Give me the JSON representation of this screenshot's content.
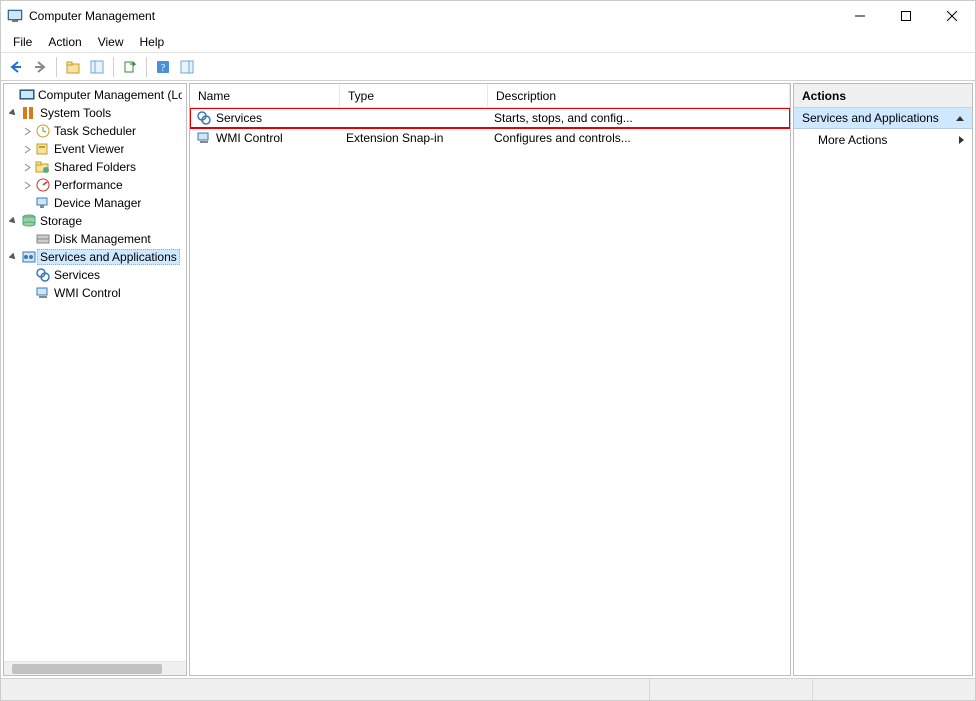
{
  "window": {
    "title": "Computer Management"
  },
  "menu": {
    "file": "File",
    "action": "Action",
    "view": "View",
    "help": "Help"
  },
  "tree": {
    "root": "Computer Management (Local)",
    "system_tools": "System Tools",
    "task_scheduler": "Task Scheduler",
    "event_viewer": "Event Viewer",
    "shared_folders": "Shared Folders",
    "performance": "Performance",
    "device_manager": "Device Manager",
    "storage": "Storage",
    "disk_management": "Disk Management",
    "services_apps": "Services and Applications",
    "services": "Services",
    "wmi_control": "WMI Control"
  },
  "list": {
    "headers": {
      "name": "Name",
      "type": "Type",
      "description": "Description"
    },
    "rows": [
      {
        "name": "Services",
        "type": "",
        "description": "Starts, stops, and config..."
      },
      {
        "name": "WMI Control",
        "type": "Extension Snap-in",
        "description": "Configures and controls..."
      }
    ]
  },
  "actions": {
    "title": "Actions",
    "group": "Services and Applications",
    "more": "More Actions"
  }
}
